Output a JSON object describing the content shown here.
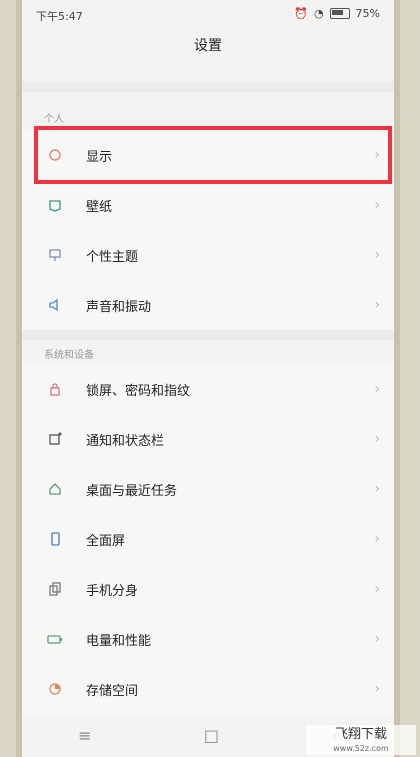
{
  "status": {
    "time": "下午5:47",
    "battery": "75%"
  },
  "header": {
    "title": "设置"
  },
  "sections": [
    {
      "header": "个人",
      "items": [
        {
          "label": "显示",
          "icon": "display-icon"
        },
        {
          "label": "壁纸",
          "icon": "wallpaper-icon"
        },
        {
          "label": "个性主题",
          "icon": "theme-icon"
        },
        {
          "label": "声音和振动",
          "icon": "sound-icon"
        }
      ]
    },
    {
      "header": "系统和设备",
      "items": [
        {
          "label": "锁屏、密码和指纹",
          "icon": "lock-icon"
        },
        {
          "label": "通知和状态栏",
          "icon": "notification-icon"
        },
        {
          "label": "桌面与最近任务",
          "icon": "home-icon"
        },
        {
          "label": "全面屏",
          "icon": "fullscreen-icon"
        },
        {
          "label": "手机分身",
          "icon": "clone-icon"
        },
        {
          "label": "电量和性能",
          "icon": "battery-icon"
        },
        {
          "label": "存储空间",
          "icon": "storage-icon"
        }
      ]
    }
  ],
  "nav": {
    "menu": "≡",
    "home": "□",
    "back": "‹"
  },
  "watermark": {
    "text": "飞翔下载",
    "url": "www.52z.com"
  },
  "colors": {
    "highlight": "#ef3340"
  }
}
